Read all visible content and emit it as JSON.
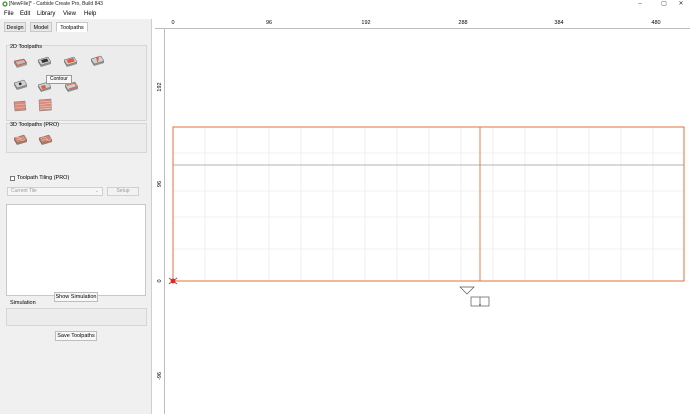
{
  "window": {
    "title": "[NewFile]* - Carbide Create Pro, Build 843",
    "minimize": "–",
    "maximize": "▢",
    "close": "✕"
  },
  "menu": [
    "File",
    "Edit",
    "Library",
    "View",
    "Help"
  ],
  "tabs": [
    {
      "label": "Design",
      "active": false
    },
    {
      "label": "Model",
      "active": false
    },
    {
      "label": "Toolpaths",
      "active": true
    }
  ],
  "toolpaths_2d": {
    "title": "2D Toolpaths",
    "tooltip": "Contour",
    "icons": [
      "contour-icon",
      "pocket-icon",
      "texture-icon",
      "vcarve-icon",
      "drill-icon",
      "advanced-vcarve-icon",
      "chamfer-icon",
      "thread-icon",
      "stepover-icon"
    ]
  },
  "toolpaths_3d": {
    "title": "3D Toolpaths (PRO)",
    "icons": [
      "3d-rough-icon",
      "3d-finish-icon"
    ]
  },
  "tiling": {
    "checkbox_label": "Toolpath Tiling (PRO)",
    "checked": false,
    "select_value": "Current Tile",
    "setup_label": "Setup"
  },
  "simulation": {
    "label": "Simulation",
    "show_button": "Show Simulation"
  },
  "save_button": "Save Toolpaths",
  "ruler": {
    "top_labels": [
      "0",
      "96",
      "192",
      "288",
      "384",
      "480"
    ],
    "left_labels": [
      "192",
      "96",
      "0",
      "-96"
    ]
  },
  "colors": {
    "stock_border": "#e0703a",
    "grid": "#e4e4e4",
    "origin": "#d42b2b"
  }
}
